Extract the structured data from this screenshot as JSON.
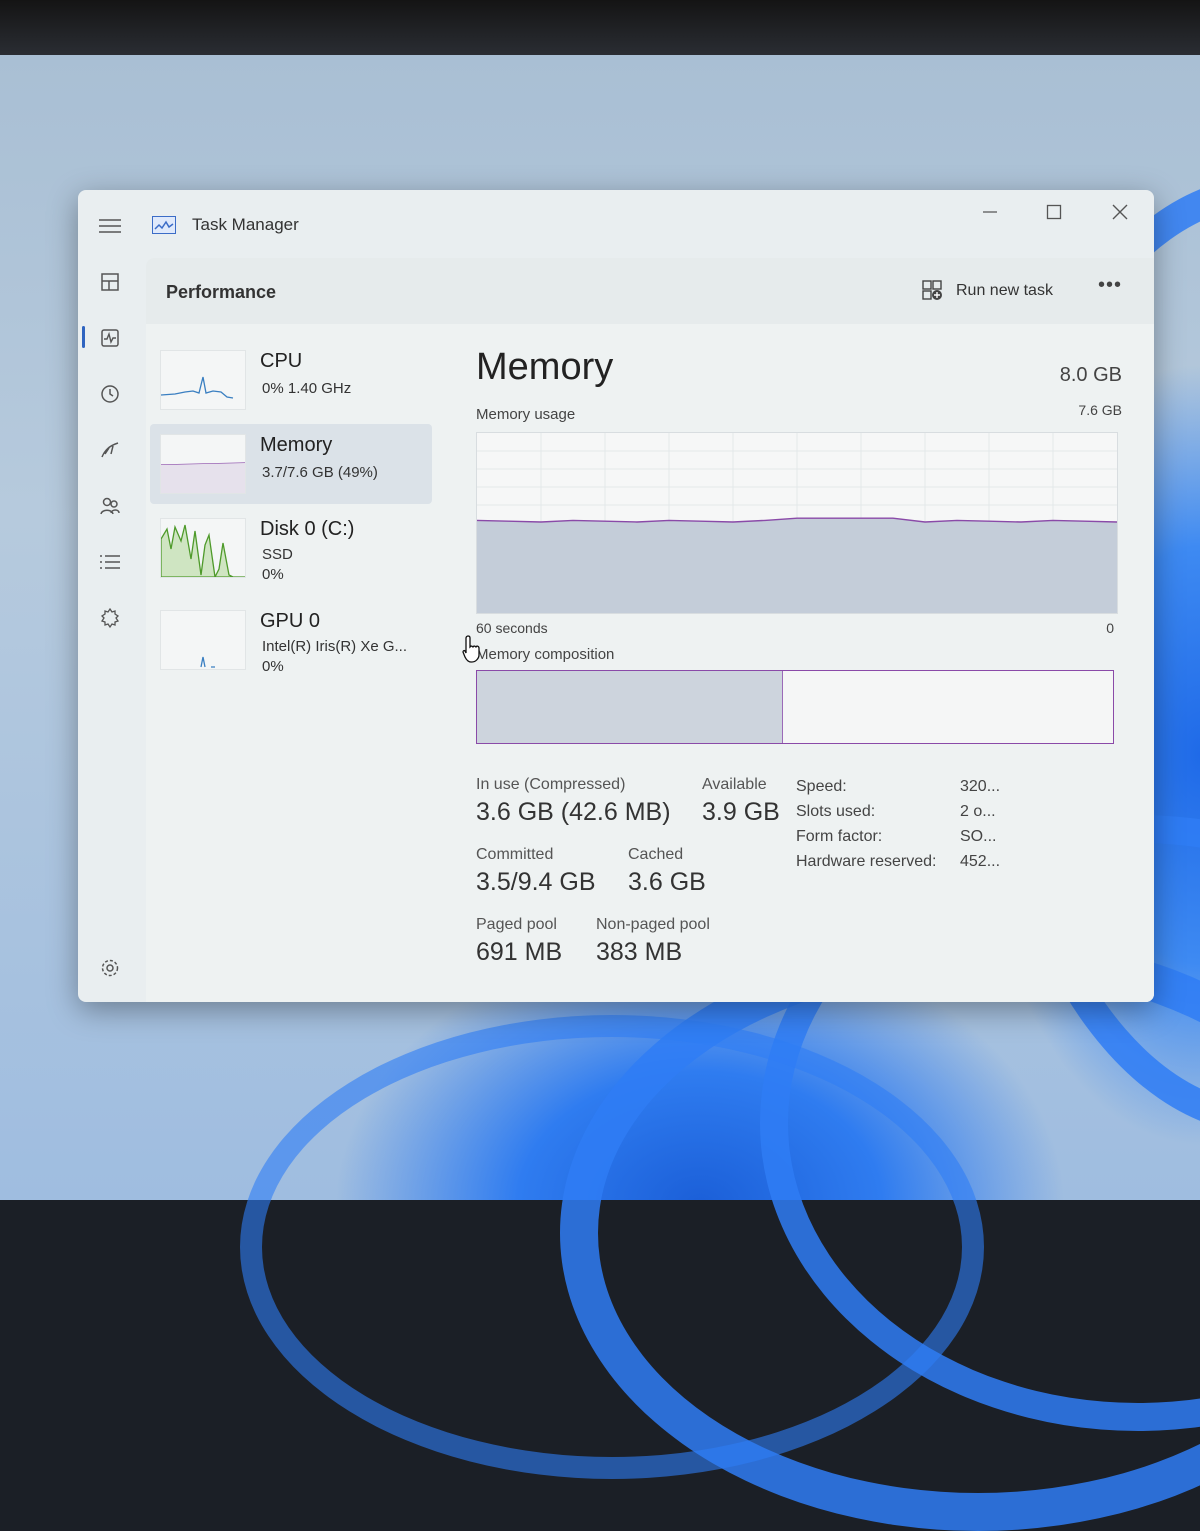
{
  "window": {
    "title": "Task Manager"
  },
  "nav": {
    "items": [
      {
        "name": "hamburger-menu-icon"
      },
      {
        "name": "processes-icon"
      },
      {
        "name": "performance-icon"
      },
      {
        "name": "app-history-icon"
      },
      {
        "name": "startup-apps-icon"
      },
      {
        "name": "users-icon"
      },
      {
        "name": "details-icon"
      },
      {
        "name": "services-icon"
      }
    ],
    "active": "performance-icon"
  },
  "header": {
    "title": "Performance",
    "run_task_label": "Run new task",
    "more_label": "•••"
  },
  "resources": [
    {
      "name": "CPU",
      "lines": [
        "0%  1.40 GHz"
      ],
      "selected": false
    },
    {
      "name": "Memory",
      "lines": [
        "3.7/7.6 GB (49%)"
      ],
      "selected": true
    },
    {
      "name": "Disk 0 (C:)",
      "lines": [
        "SSD",
        "0%"
      ],
      "selected": false
    },
    {
      "name": "GPU 0",
      "lines": [
        "Intel(R) Iris(R) Xe G...",
        "0%"
      ],
      "selected": false
    }
  ],
  "detail": {
    "title": "Memory",
    "total": "8.0 GB",
    "usage_caption": "Memory usage",
    "usage_max": "7.6 GB",
    "axis_left": "60 seconds",
    "axis_right": "0",
    "usage_level": 0.51,
    "composition_caption": "Memory composition",
    "composition_in_use_fraction": 0.48,
    "stats": {
      "in_use_label": "In use (Compressed)",
      "in_use_value": "3.6 GB (42.6 MB)",
      "available_label": "Available",
      "available_value": "3.9 GB",
      "committed_label": "Committed",
      "committed_value": "3.5/9.4 GB",
      "cached_label": "Cached",
      "cached_value": "3.6 GB",
      "paged_label": "Paged pool",
      "paged_value": "691 MB",
      "nonpaged_label": "Non-paged pool",
      "nonpaged_value": "383 MB"
    },
    "specs": [
      {
        "label": "Speed:",
        "value": "320..."
      },
      {
        "label": "Slots used:",
        "value": "2 o..."
      },
      {
        "label": "Form factor:",
        "value": "SO..."
      },
      {
        "label": "Hardware reserved:",
        "value": "452..."
      }
    ]
  },
  "colors": {
    "memory_line": "#8a4aa8",
    "disk_line": "#4e9a2a",
    "cpu_line": "#3a7fc1",
    "accent": "#2f64c0"
  }
}
